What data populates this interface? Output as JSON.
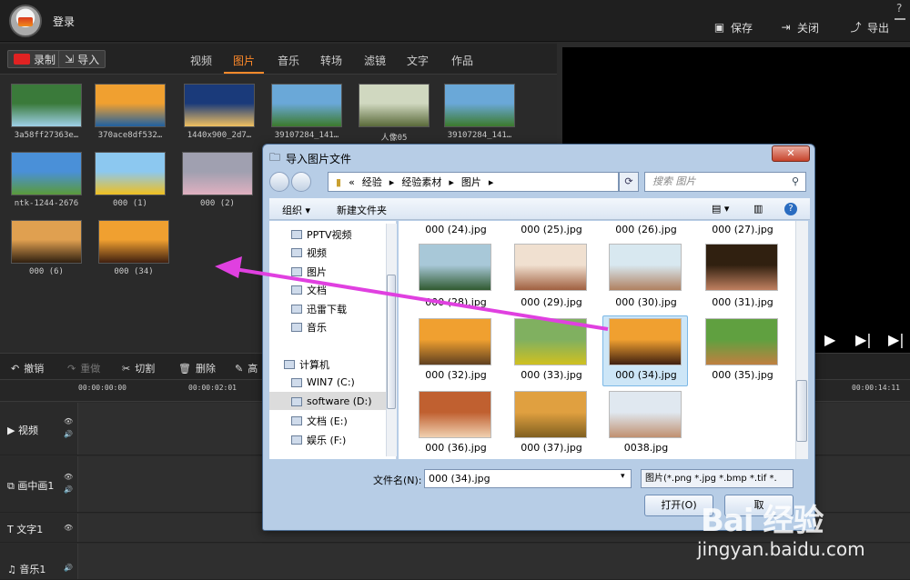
{
  "app": {
    "login": "登录",
    "help": "?",
    "actions": {
      "save": "保存",
      "close": "关闭",
      "export": "导出"
    }
  },
  "media": {
    "record_label": "录制",
    "import_label": "导入",
    "categories": [
      "视频",
      "图片",
      "音乐",
      "转场",
      "滤镜",
      "文字",
      "作品"
    ],
    "active_category": "图片",
    "items": [
      {
        "label": "3a58ff27363e…",
        "colors": [
          "#3a7a3a",
          "#9fd0e8"
        ]
      },
      {
        "label": "370ace8df532…",
        "colors": [
          "#f0a030",
          "#2060a0"
        ]
      },
      {
        "label": "1440x900_2d7…",
        "colors": [
          "#1a3a7a",
          "#f0c060"
        ]
      },
      {
        "label": "39107284_141…",
        "colors": [
          "#6aa8d8",
          "#3c7a2c"
        ]
      },
      {
        "label": "人像05",
        "colors": [
          "#d0d8c0",
          "#5a6a3a"
        ]
      },
      {
        "label": "39107284_141…",
        "colors": [
          "#6aa8d8",
          "#3c7a2c"
        ]
      },
      {
        "label": "ntk-1244-2676",
        "colors": [
          "#4a90d8",
          "#5a9a3a"
        ]
      },
      {
        "label": "000 (1)",
        "colors": [
          "#8cc8f0",
          "#f0c020"
        ]
      },
      {
        "label": "000 (2)",
        "colors": [
          "#a0a0b0",
          "#e0b0c0"
        ]
      },
      {
        "label": "000 (6)",
        "colors": [
          "#e0a050",
          "#302010"
        ]
      },
      {
        "label": "000 (34)",
        "colors": [
          "#f0a030",
          "#402010"
        ]
      }
    ]
  },
  "toolbar": {
    "undo": "撤销",
    "redo": "重做",
    "cut": "切割",
    "delete": "删除",
    "more": "高"
  },
  "timeline": {
    "ticks": [
      "00:00:00:00",
      "00:00:02:01",
      "00:00:14:11"
    ],
    "tracks": [
      "视频",
      "画中画1",
      "文字1",
      "音乐1"
    ]
  },
  "dialog": {
    "title": "导入图片文件",
    "close": "✕",
    "breadcrumb": [
      "«",
      "经验",
      "经验素材",
      "图片"
    ],
    "search_placeholder": "搜索 图片",
    "organize": "组织 ▾",
    "new_folder": "新建文件夹",
    "nav": [
      {
        "label": "PPTV视频"
      },
      {
        "label": "视频"
      },
      {
        "label": "图片"
      },
      {
        "label": "文档"
      },
      {
        "label": "迅雷下载"
      },
      {
        "label": "音乐"
      },
      {
        "label": "计算机"
      },
      {
        "label": "WIN7 (C:)"
      },
      {
        "label": "software (D:)"
      },
      {
        "label": "文档 (E:)"
      },
      {
        "label": "娱乐 (F:)"
      }
    ],
    "top_row": [
      "000 (24).jpg",
      "000 (25).jpg",
      "000 (26).jpg",
      "000 (27).jpg"
    ],
    "files": [
      {
        "name": "000 (28).jpg",
        "colors": [
          "#a8c8d8",
          "#305a30"
        ]
      },
      {
        "name": "000 (29).jpg",
        "colors": [
          "#f0e0d0",
          "#a06040"
        ]
      },
      {
        "name": "000 (30).jpg",
        "colors": [
          "#d8e8f0",
          "#b08060"
        ]
      },
      {
        "name": "000 (31).jpg",
        "colors": [
          "#302010",
          "#c08060"
        ]
      },
      {
        "name": "000 (32).jpg",
        "colors": [
          "#f0a030",
          "#604020"
        ]
      },
      {
        "name": "000 (33).jpg",
        "colors": [
          "#80b060",
          "#d0c020"
        ]
      },
      {
        "name": "000 (34).jpg",
        "colors": [
          "#f0a030",
          "#402010"
        ]
      },
      {
        "name": "000 (35).jpg",
        "colors": [
          "#60a040",
          "#c08040"
        ]
      },
      {
        "name": "000 (36).jpg",
        "colors": [
          "#c06030",
          "#f0d0b0"
        ]
      },
      {
        "name": "000 (37).jpg",
        "colors": [
          "#e0a040",
          "#806020"
        ]
      },
      {
        "name": "0038.jpg",
        "colors": [
          "#e0e8f0",
          "#c09070"
        ]
      }
    ],
    "selected_file": "000 (34).jpg",
    "filename_label": "文件名(N):",
    "filename_value": "000 (34).jpg",
    "filter": "图片(*.png *.jpg *.bmp *.tif *.",
    "open": "打开(O)",
    "cancel": "取"
  },
  "watermark": {
    "logo": "Bai 经验",
    "url": "jingyan.baidu.com"
  },
  "colors": {
    "accent": "#ff8a2a",
    "arrow": "#e040e0"
  }
}
